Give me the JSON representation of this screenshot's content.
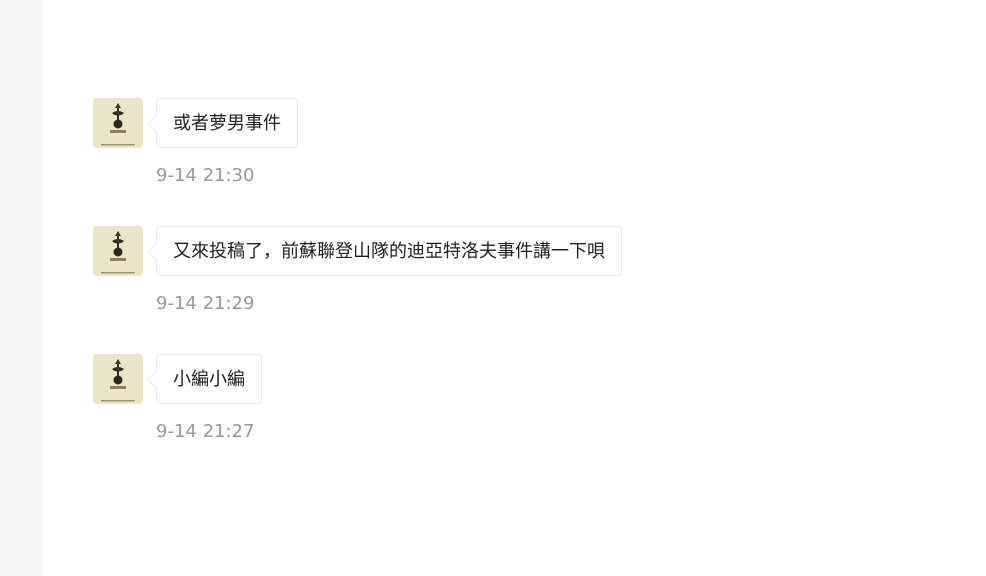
{
  "messages": [
    {
      "avatar_icon": "tottenham-crest-icon",
      "text": "或者萝男事件",
      "time": "9-14 21:30"
    },
    {
      "avatar_icon": "tottenham-crest-icon",
      "text": "又來投稿了，前蘇聯登山隊的迪亞特洛夫事件講一下唄",
      "time": "9-14 21:29"
    },
    {
      "avatar_icon": "tottenham-crest-icon",
      "text": "小編小編",
      "time": "9-14 21:27"
    }
  ],
  "colors": {
    "sidebar_bg": "#f5f6f8",
    "bubble_border": "#e8e8e8",
    "text": "#222222",
    "timestamp": "#999999",
    "avatar_bg": "#ece4c8"
  }
}
